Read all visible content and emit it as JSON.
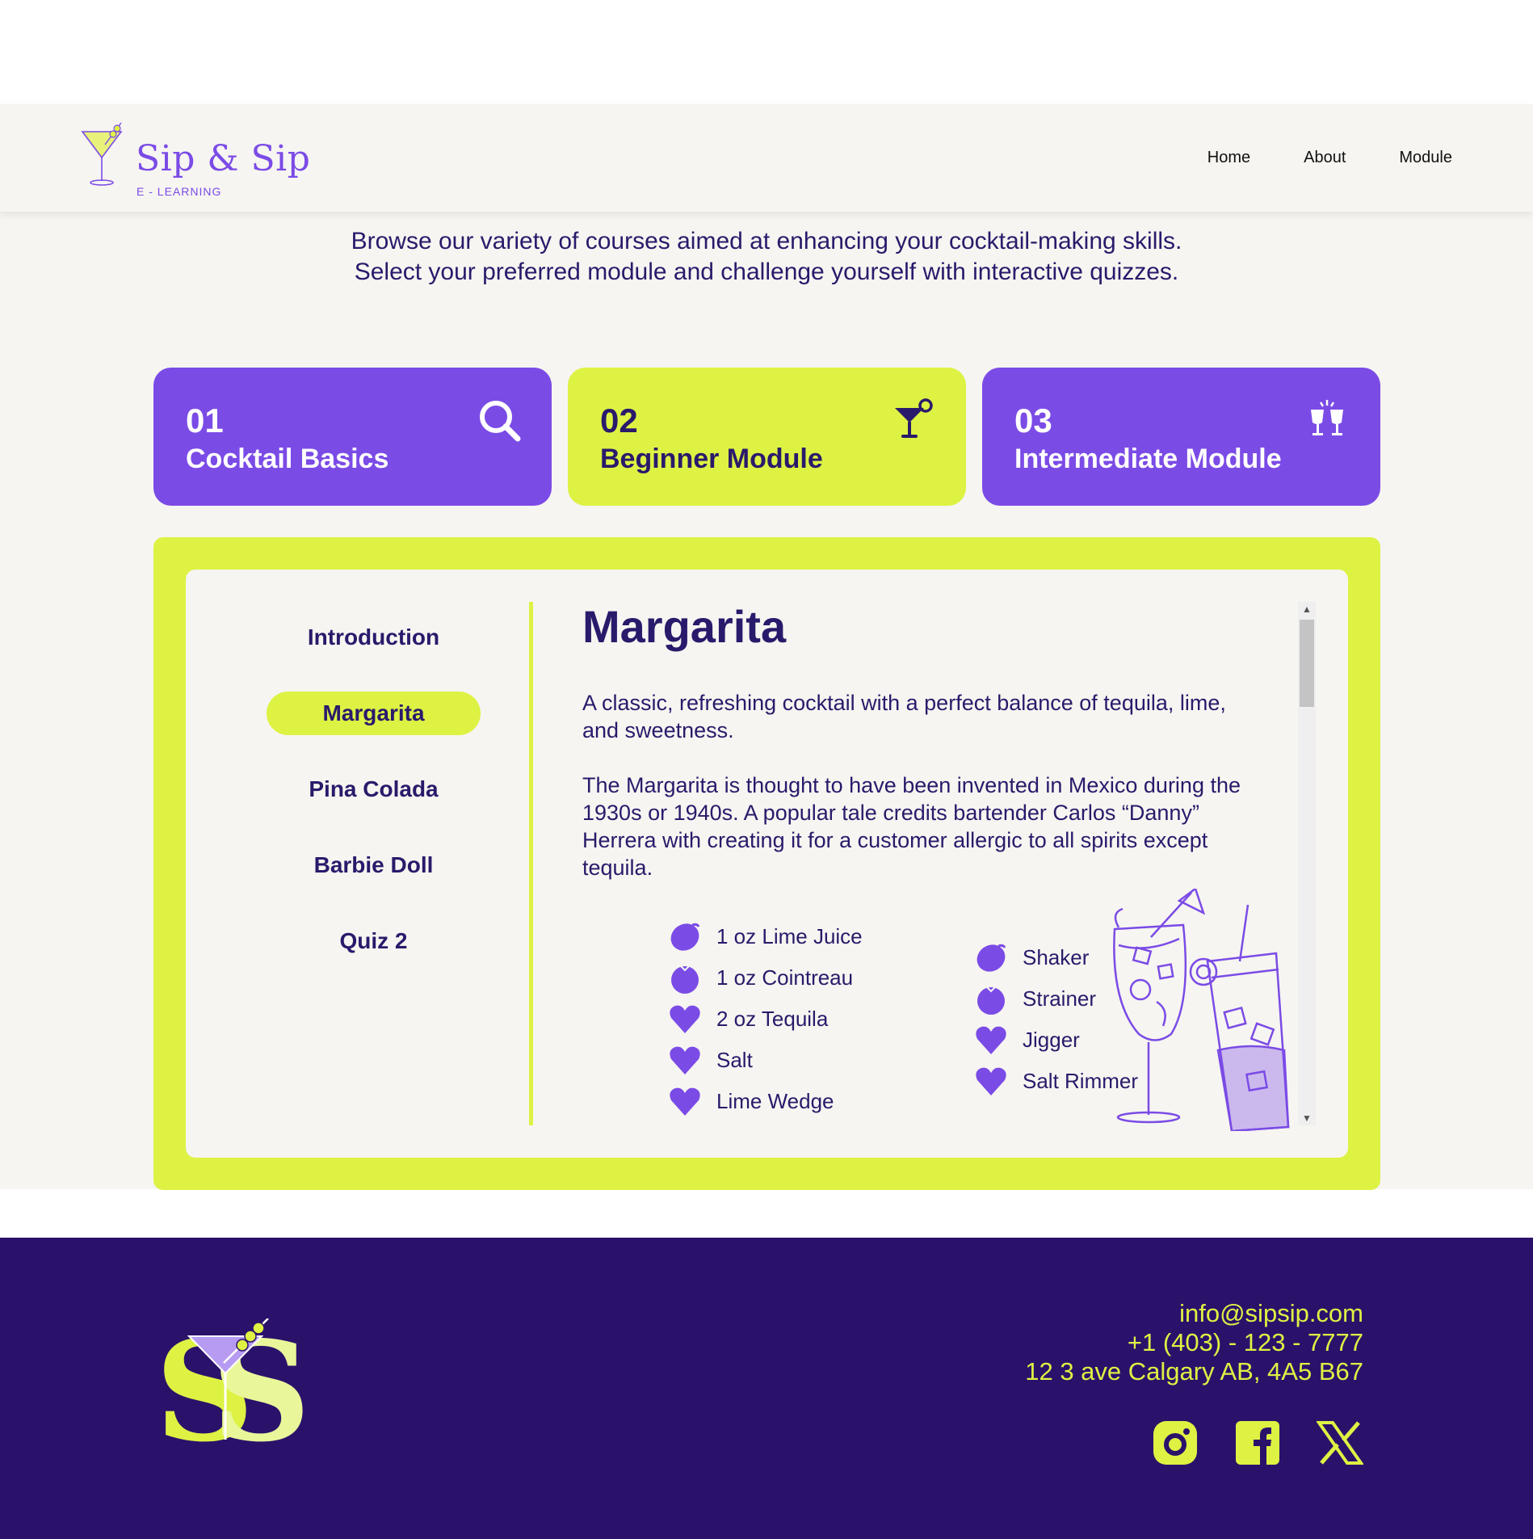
{
  "brand": {
    "title": "Sip & Sip",
    "subtitle": "E - LEARNING"
  },
  "nav": {
    "home": "Home",
    "about": "About",
    "module": "Module"
  },
  "intro": {
    "line1": "Browse our variety of courses aimed at enhancing your cocktail-making skills.",
    "line2": "Select your preferred module and challenge yourself with interactive quizzes."
  },
  "modules": [
    {
      "num": "01",
      "label": "Cocktail Basics",
      "icon": "search-icon",
      "color": "#7b4be6",
      "selected": false
    },
    {
      "num": "02",
      "label": "Beginner Module",
      "icon": "cocktail-icon",
      "color": "#ddf243",
      "selected": true
    },
    {
      "num": "03",
      "label": "Intermediate Module",
      "icon": "cheers-icon",
      "color": "#7b4be6",
      "selected": false
    }
  ],
  "lessons": [
    {
      "label": "Introduction",
      "active": false
    },
    {
      "label": "Margarita",
      "active": true
    },
    {
      "label": "Pina Colada",
      "active": false
    },
    {
      "label": "Barbie Doll",
      "active": false
    },
    {
      "label": "Quiz 2",
      "active": false
    }
  ],
  "lesson": {
    "title": "Margarita",
    "para1": "A classic, refreshing cocktail with a perfect balance of tequila, lime, and sweetness.",
    "para2": "The Margarita is thought to have been invented in Mexico during the 1930s or 1940s. A popular tale credits bartender Carlos “Danny” Herrera with creating it for a customer allergic to all spirits except tequila.",
    "ingredients": [
      {
        "text": "1 oz Lime Juice",
        "icon": "lime-icon"
      },
      {
        "text": "1 oz Cointreau",
        "icon": "berry-icon"
      },
      {
        "text": "2 oz Tequila",
        "icon": "heart-icon"
      },
      {
        "text": "Salt",
        "icon": "heart-icon"
      },
      {
        "text": "Lime Wedge",
        "icon": "heart-icon"
      }
    ],
    "tools": [
      {
        "text": "Shaker",
        "icon": "lime-icon"
      },
      {
        "text": "Strainer",
        "icon": "berry-icon"
      },
      {
        "text": "Jigger",
        "icon": "heart-icon"
      },
      {
        "text": "Salt Rimmer",
        "icon": "heart-icon"
      }
    ]
  },
  "footer": {
    "email": "info@sipsip.com",
    "phone": "+1 (403) - 123 - 7777",
    "address": "12 3 ave Calgary AB, 4A5 B67",
    "socials": [
      "instagram-icon",
      "facebook-icon",
      "x-icon"
    ]
  },
  "colors": {
    "purple": "#7b4be6",
    "lime": "#ddf243",
    "navy": "#2a126b",
    "text": "#2a1a6b",
    "background": "#f6f5f1"
  }
}
